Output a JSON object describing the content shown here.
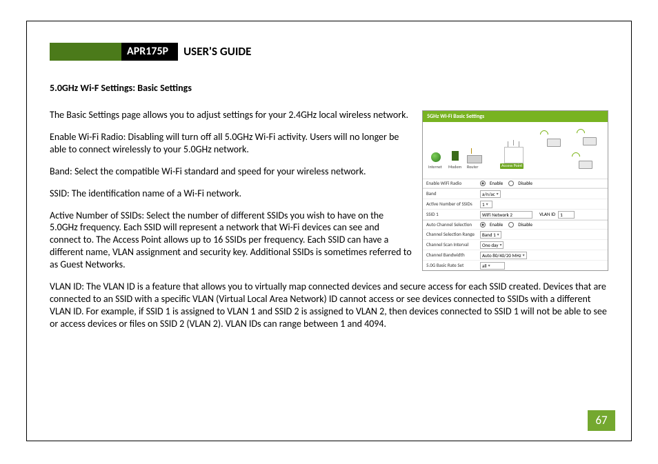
{
  "header": {
    "model": "APR175P",
    "guide": "USER'S GUIDE"
  },
  "section_title": "5.0GHz Wi-F Settings: Basic Settings",
  "paragraphs": {
    "p1": "The Basic Settings page allows you to adjust settings for your 2.4GHz local wireless network.",
    "p2": "Enable Wi-Fi Radio: Disabling will turn off all 5.0GHz Wi-Fi activity.  Users will no longer be able to connect wirelessly to your 5.0GHz network.",
    "p3": "Band: Select the compatible Wi-Fi standard and speed for your wireless network.",
    "p4": "SSID: The identification name of a Wi-Fi network.",
    "p5": "Active Number of SSIDs: Select the number of different SSIDs you wish to have on the 5.0GHz frequency.  Each SSID will represent a network that Wi-Fi devices can see and connect to.  The Access Point allows up to 16 SSIDs per frequency.  Each SSID can have a different name, VLAN assignment and security key.  Additional SSIDs is sometimes referred to as Guest Networks.",
    "p6": "VLAN ID: The VLAN ID is a feature that allows you to virtually map connected devices and secure access for each SSID created.  Devices that are connected to an SSID with a specific VLAN (Virtual Local Area Network) ID cannot access or see devices connected to SSIDs with a different VLAN ID.  For example, if SSID 1 is assigned to VLAN 1 and SSID 2 is assigned to VLAN 2, then devices connected to SSID 1 will not be able to see or access devices or files on SSID 2 (VLAN 2).  VLAN IDs can range between 1 and 4094."
  },
  "figure": {
    "title": "5GHz Wi-Fi Basic Settings",
    "diagram": {
      "internet": "Internet",
      "modem": "Modem",
      "router": "Router",
      "ap": "Access Point"
    },
    "rows": {
      "enable_radio_label": "Enable WiFi Radio",
      "enable_radio_on": "Enable",
      "enable_radio_off": "Disable",
      "band_label": "Band",
      "band_value": "a/n/ac",
      "active_ssids_label": "Active Number of SSIDs",
      "active_ssids_value": "1",
      "ssid1_label": "SSID 1",
      "ssid1_value": "WiFi Network 2",
      "vlan_id_label": "VLAN ID",
      "vlan_id_value": "1",
      "auto_channel_label": "Auto Channel Selection",
      "auto_channel_on": "Enable",
      "auto_channel_off": "Disable",
      "channel_range_label": "Channel Selection Range",
      "channel_range_value": "Band 1",
      "scan_interval_label": "Channel Scan Interval",
      "scan_interval_value": "One day",
      "bandwidth_label": "Channel Bandwidth",
      "bandwidth_value": "Auto 80/40/20 MHz",
      "rate_label": "5.0G Basic Rate Set",
      "rate_value": "all"
    }
  },
  "page_number": "67"
}
